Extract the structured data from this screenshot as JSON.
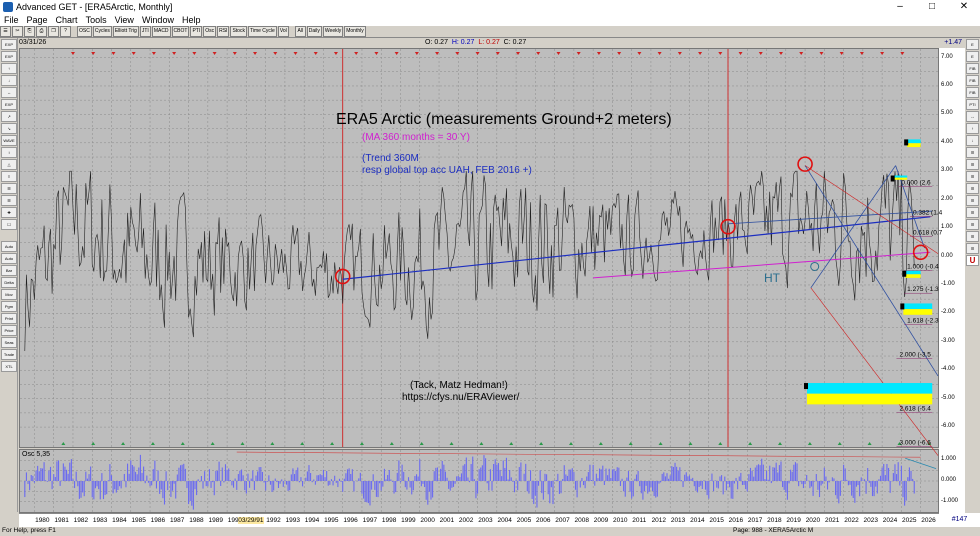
{
  "window": {
    "title": "Advanced GET - [ERA5Arctic, Monthly]",
    "controls": [
      "–",
      "□",
      "✕"
    ]
  },
  "menu": [
    "File",
    "Page",
    "Chart",
    "Tools",
    "View",
    "Window",
    "Help"
  ],
  "toolbar": [
    "☰",
    "✂",
    "⎘",
    "⎙",
    "❐",
    "?",
    "OSC",
    "Cycles",
    "Elliott Trig",
    "JTI",
    "MACD",
    "CBOT",
    "PTI",
    "Osc",
    "RSI",
    "Stock",
    "Time Cycle",
    "Vol",
    "All",
    "Daily",
    "Weekly",
    "Monthly"
  ],
  "info": {
    "date": "03/31/26",
    "open": "O: 0.27",
    "high": "H: 0.27",
    "low": "L: 0.27",
    "close": "C: 0.27",
    "last_value": "+1.47"
  },
  "left_tools": [
    "EXP",
    "EXP",
    "↑",
    "↓",
    "↔",
    "EXP",
    "↗",
    "↘",
    "WAVE",
    "↕",
    "△",
    "≡",
    "☰",
    "☰",
    "✚",
    "☐",
    "Auto Gann",
    "Auto Trend",
    "Bar Stats",
    "Delta",
    "Mov Ave",
    "Pgm Stat",
    "Print",
    "Price Chart",
    "Seas Fan",
    "Trade Profile",
    "XTL"
  ],
  "right_tools": [
    "E",
    "E",
    "FIB EXT",
    "FIB EXT",
    "FIB RET",
    "PTI",
    "↔",
    "↑",
    "↓",
    "☰",
    "☰",
    "☰",
    "☰",
    "☰",
    "☰",
    "☰",
    "☰",
    "☰",
    "U"
  ],
  "annotations": {
    "title": "ERA5 Arctic (measurements Ground+2 meters)",
    "ma_note": "(MA 360 months = 30 Y)",
    "trend_note": "(Trend 360M",
    "trend_note2": "resp global top acc UAH, FEB 2016 +)",
    "thanks": "(Tack, Matz Hedman!)",
    "url": "https://cfys.nu/ERAViewer/",
    "ht": "HT"
  },
  "fib_labels": [
    "0.000 (2.6",
    "0.382 (1.4",
    "0.618 (0.7",
    "1.000 (-0.4",
    "1.275 (-1.3",
    "1.618 (-2.3",
    "2.000 (-3.5",
    "2.618 (-5.4",
    "3.000 (-6.6"
  ],
  "osc": {
    "label": "Osc 5,35"
  },
  "status": {
    "help": "For Help, press F1",
    "page": "Page: 988 - XERA5Arctic M"
  },
  "bar_count": "#147",
  "colors": {
    "price": "#202020",
    "trend": "#1c2ec0",
    "ma": "#d020d0",
    "cycle": "#d02020",
    "highlight_cyan": "#00e8ff",
    "highlight_yellow": "#ffff00",
    "osc_bars": "#6a6af0"
  },
  "chart_data": {
    "type": "line",
    "title": "ERA5 Arctic (measurements Ground+2 meters)",
    "xlabel": "",
    "ylabel": "",
    "xlim": [
      "1980-01",
      "2026-03"
    ],
    "ylim": [
      -6.7,
      7.3
    ],
    "y_ticks": [
      "7.00",
      "6.00",
      "5.00",
      "4.00",
      "3.00",
      "2.00",
      "1.00",
      "0.00",
      "-1.00",
      "-2.00",
      "-3.00",
      "-4.00",
      "-5.00",
      "-6.00"
    ],
    "x_ticks": [
      "1980",
      "1981",
      "1982",
      "1983",
      "1984",
      "1985",
      "1986",
      "1987",
      "1988",
      "1989",
      "1990",
      "03/29/91",
      "1992",
      "1993",
      "1994",
      "1995",
      "1996",
      "1997",
      "1998",
      "1999",
      "2000",
      "2001",
      "2002",
      "2003",
      "2004",
      "2005",
      "2006",
      "2007",
      "2008",
      "2009",
      "2010",
      "2011",
      "2012",
      "2013",
      "2014",
      "2015",
      "2016",
      "2017",
      "2018",
      "2019",
      "2020",
      "2021",
      "2022",
      "2023",
      "2024",
      "2025",
      "2026"
    ],
    "osc_ylim": [
      -1.5,
      1.5
    ],
    "osc_ticks": [
      "1.000",
      "0.000",
      "-1.000"
    ],
    "series": [
      {
        "kind": "monthly anomaly",
        "x": [
          1979.5,
          1982.0,
          1985.0,
          1990.0,
          1996.0,
          2000.0,
          2005.0,
          2010.0,
          2016.0,
          2020.0,
          2024.0,
          2026.2
        ],
        "y": [
          -1.6,
          1.4,
          0.0,
          -0.3,
          -0.5,
          -0.2,
          0.5,
          0.6,
          1.0,
          1.3,
          1.2,
          0.27
        ]
      },
      {
        "kind": "trend 360M",
        "x": [
          1996.0,
          2026.5
        ],
        "y": [
          -0.8,
          1.4
        ]
      },
      {
        "kind": "MA 360",
        "x": [
          2009.0,
          2026.5
        ],
        "y": [
          -0.75,
          0.15
        ]
      }
    ],
    "markers": [
      {
        "kind": "circle",
        "x": 1996.0,
        "y": -0.7
      },
      {
        "kind": "circle",
        "x": 2016.0,
        "y": 1.05
      },
      {
        "kind": "circle",
        "x": 2020.0,
        "y": 3.25
      },
      {
        "kind": "circle",
        "x": 2026.0,
        "y": 0.15
      }
    ],
    "vertical_cycle_lines": [
      1996.0,
      2016.0
    ]
  }
}
